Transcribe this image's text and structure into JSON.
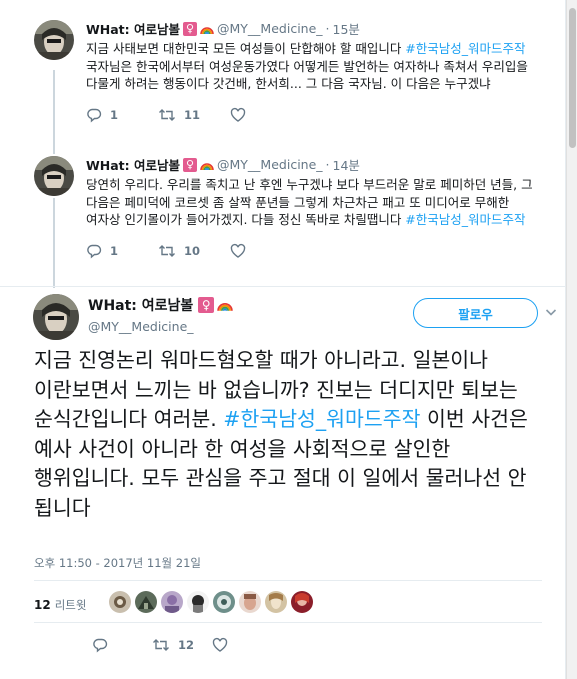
{
  "replies": [
    {
      "author_name": "WHat: 여로남볼",
      "female_symbol": "♀",
      "handle": "@MY__Medicine_",
      "dot": "·",
      "time": "15분",
      "text_before": "지금 사태보면 대한민국 모든 여성들이 단합해야 할 때입니다 ",
      "hashtag": "#한국남성_워마드주작",
      "text_after": " 국자님은 한국에서부터 여성운동가였다 어떻게든 발언하는 여자하나 족쳐서 우리입을 다물게 하려는 행동이다 갓건배, 한서희... 그 다음 국자님. 이 다음은 누구겠냐",
      "replies": "1",
      "retweets": "11",
      "likes": ""
    },
    {
      "author_name": "WHat: 여로남볼",
      "female_symbol": "♀",
      "handle": "@MY__Medicine_",
      "dot": "·",
      "time": "14분",
      "text_before": "당연히 우리다. 우리를 족치고 난 후엔 누구겠냐 보다 부드러운 말로 페미하던 년들, 그 다음은 페미덕에 코르셋 좀 살짝 푼년들 그렇게 차근차근 패고 또 미디어로 무해한 여자상 인기몰이가 들어가겠지. 다들 정신 똑바로 차릴땝니다 ",
      "hashtag": "#한국남성_워마드주작",
      "text_after": "",
      "replies": "1",
      "retweets": "10",
      "likes": ""
    }
  ],
  "main_tweet": {
    "author_name": "WHat: 여로남볼",
    "female_symbol": "♀",
    "handle": "@MY__Medicine_",
    "follow_label": "팔로우",
    "text_before": "지금 진영논리 워마드혐오할 때가 아니라고. 일본이나 이란보면서 느끼는 바 없습니까? 진보는 더디지만 퇴보는 순식간입니다 여러분. ",
    "hashtag": "#한국남성_워마드주작",
    "text_after": " 이번 사건은 예사 사건이 아니라 한 여성을 사회적으로 살인한 행위입니다. 모두 관심을 주고 절대 이 일에서 물러나선 안 됩니다",
    "timestamp": "오후 11:50 - 2017년 11월 21일",
    "retweet_count": "12",
    "retweet_label": "리트윗",
    "replies": "",
    "retweets": "12",
    "likes": ""
  },
  "icons": [
    "reply-icon",
    "retweet-icon",
    "heart-icon",
    "chevron-down-icon",
    "rainbow-flag-icon",
    "female-sign-icon"
  ],
  "colors": {
    "accent": "#1da1f2",
    "muted": "#657786",
    "text": "#14171a",
    "female_badge": "#e35b8f"
  }
}
